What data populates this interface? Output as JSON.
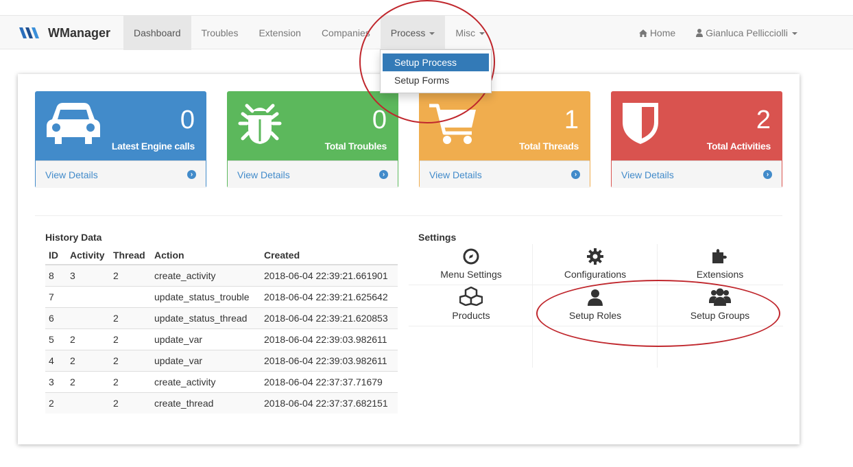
{
  "brand": {
    "name": "WManager"
  },
  "nav": {
    "items": [
      {
        "label": "Dashboard"
      },
      {
        "label": "Troubles"
      },
      {
        "label": "Extension"
      },
      {
        "label": "Companies"
      },
      {
        "label": "Process"
      },
      {
        "label": "Misc"
      }
    ],
    "home": "Home",
    "user": "Gianluca Pellicciolli"
  },
  "process_menu": {
    "items": [
      "Setup Process",
      "Setup Forms"
    ]
  },
  "cards": [
    {
      "value": "0",
      "label": "Latest Engine calls",
      "footer": "View Details",
      "color": "#428bca",
      "icon": "car-icon"
    },
    {
      "value": "0",
      "label": "Total Troubles",
      "footer": "View Details",
      "color": "#5cb85c",
      "icon": "bug-icon"
    },
    {
      "value": "1",
      "label": "Total Threads",
      "footer": "View Details",
      "color": "#f0ad4e",
      "icon": "cart-icon"
    },
    {
      "value": "2",
      "label": "Total Activities",
      "footer": "View Details",
      "color": "#d9534f",
      "icon": "shield-icon"
    }
  ],
  "history": {
    "title": "History Data",
    "columns": [
      "ID",
      "Activity",
      "Thread",
      "Action",
      "Created"
    ],
    "rows": [
      [
        "8",
        "3",
        "2",
        "create_activity",
        "2018-06-04 22:39:21.661901"
      ],
      [
        "7",
        "",
        "",
        "update_status_trouble",
        "2018-06-04 22:39:21.625642"
      ],
      [
        "6",
        "",
        "2",
        "update_status_thread",
        "2018-06-04 22:39:21.620853"
      ],
      [
        "5",
        "2",
        "2",
        "update_var",
        "2018-06-04 22:39:03.982611"
      ],
      [
        "4",
        "2",
        "2",
        "update_var",
        "2018-06-04 22:39:03.982611"
      ],
      [
        "3",
        "2",
        "2",
        "create_activity",
        "2018-06-04 22:37:37.71679"
      ],
      [
        "2",
        "",
        "2",
        "create_thread",
        "2018-06-04 22:37:37.682151"
      ]
    ]
  },
  "settings": {
    "title": "Settings",
    "items": [
      {
        "label": "Menu Settings",
        "icon": "compass-icon"
      },
      {
        "label": "Configurations",
        "icon": "gear-icon"
      },
      {
        "label": "Extensions",
        "icon": "puzzle-icon"
      },
      {
        "label": "Products",
        "icon": "cubes-icon"
      },
      {
        "label": "Setup Roles",
        "icon": "user-icon"
      },
      {
        "label": "Setup Groups",
        "icon": "users-icon"
      }
    ]
  }
}
